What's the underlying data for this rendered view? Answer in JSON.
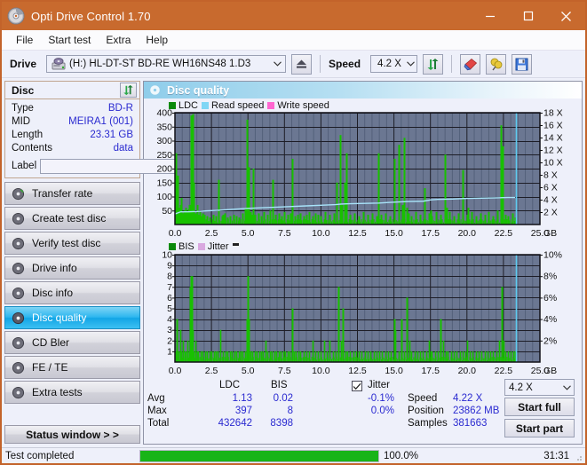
{
  "window": {
    "title": "Opti Drive Control 1.70",
    "icon": "disc-icon",
    "minimize": "minimize-icon",
    "maximize": "maximize-icon",
    "close": "close-icon"
  },
  "menu": {
    "items": [
      "File",
      "Start test",
      "Extra",
      "Help"
    ]
  },
  "toolbar": {
    "drive_label": "Drive",
    "drive_value": "(H:)   HL-DT-ST BD-RE  WH16NS48 1.D3",
    "eject_icon": "eject-icon",
    "speed_label": "Speed",
    "speed_value": "4.2 X",
    "refresh_icon": "refresh-icon",
    "erase_icon": "eraser-icon",
    "settings_icon": "plug-icon",
    "save_icon": "floppy-save-icon"
  },
  "sidebar": {
    "disc_panel": {
      "title": "Disc",
      "refresh_icon": "refresh-icon",
      "rows": [
        {
          "key": "Type",
          "value": "BD-R"
        },
        {
          "key": "MID",
          "value": "MEIRA1 (001)"
        },
        {
          "key": "Length",
          "value": "23.31 GB"
        },
        {
          "key": "Contents",
          "value": "data"
        }
      ],
      "label_key": "Label",
      "label_value": "",
      "label_placeholder": "",
      "disc_button_icon": "cd-icon"
    },
    "items": [
      {
        "label": "Transfer rate",
        "icon": "disc-icon",
        "active": false
      },
      {
        "label": "Create test disc",
        "icon": "disc-icon",
        "active": false
      },
      {
        "label": "Verify test disc",
        "icon": "disc-icon",
        "active": false
      },
      {
        "label": "Drive info",
        "icon": "disc-icon",
        "active": false
      },
      {
        "label": "Disc info",
        "icon": "disc-icon",
        "active": false
      },
      {
        "label": "Disc quality",
        "icon": "disc-icon",
        "active": true
      },
      {
        "label": "CD Bler",
        "icon": "disc-icon",
        "active": false
      },
      {
        "label": "FE / TE",
        "icon": "disc-icon",
        "active": false
      },
      {
        "label": "Extra tests",
        "icon": "disc-icon",
        "active": false
      }
    ],
    "status_window_button": "Status window > >"
  },
  "main": {
    "header_title": "Disc quality",
    "header_icon": "disc-icon"
  },
  "stats": {
    "col_ldc": "LDC",
    "col_bis": "BIS",
    "rows": [
      {
        "label": "Avg",
        "ldc": "1.13",
        "bis": "0.02"
      },
      {
        "label": "Max",
        "ldc": "397",
        "bis": "8"
      },
      {
        "label": "Total",
        "ldc": "432642",
        "bis": "8398"
      }
    ],
    "jitter_checked": true,
    "jitter_label": "Jitter",
    "jitter_values": [
      "-0.1%",
      "0.0%"
    ],
    "speed_label": "Speed",
    "speed_value": "4.22 X",
    "position_label": "Position",
    "position_value": "23862 MB",
    "samples_label": "Samples",
    "samples_value": "381663",
    "speed_select": "4.2 X",
    "start_full_button": "Start full",
    "start_part_button": "Start part"
  },
  "statusbar": {
    "text": "Test completed",
    "progress_percent": 100.0,
    "progress_text": "100.0%",
    "elapsed": "31:31"
  },
  "colors": {
    "titlebar": "#c86a2e",
    "accent_blue": "#2bb6ef",
    "ldc_green": "#18c000",
    "read_speed": "#7fd6f5",
    "write_speed": "#ff66d0",
    "bis_green": "#18c000",
    "jitter": "#d9a8e0",
    "plot_bg": "#6b7792",
    "value_blue": "#2a2ad0",
    "progress_green": "#18b418"
  },
  "chart_data": [
    {
      "type": "line",
      "name": "ldc-chart",
      "title": "",
      "xlabel": "GB",
      "ylabel": "",
      "xlim": [
        0,
        25.0
      ],
      "xticks": [
        "0.0",
        "2.5",
        "5.0",
        "7.5",
        "10.0",
        "12.5",
        "15.0",
        "17.5",
        "20.0",
        "22.5",
        "25.0"
      ],
      "ylim": [
        0,
        400
      ],
      "yticks": [
        "50",
        "100",
        "150",
        "200",
        "250",
        "300",
        "350",
        "400"
      ],
      "y2lim": [
        0,
        18
      ],
      "y2ticks": [
        "2 X",
        "4 X",
        "6 X",
        "8 X",
        "10 X",
        "12 X",
        "14 X",
        "16 X",
        "18 X"
      ],
      "grid": true,
      "legend": [
        {
          "label": "LDC",
          "color": "#18c000"
        },
        {
          "label": "Read speed",
          "color": "#7fd6f5"
        },
        {
          "label": "Write speed",
          "color": "#ff66d0"
        }
      ],
      "series": [
        {
          "name": "LDC",
          "color": "#18c000",
          "kind": "impulse",
          "x": [
            0.05,
            0.12,
            0.2,
            0.3,
            0.38,
            0.45,
            0.55,
            0.62,
            0.7,
            0.8,
            0.9,
            1.0,
            1.1,
            1.15,
            1.2,
            1.25,
            1.3,
            1.4,
            1.5,
            1.6,
            1.7,
            1.8,
            1.9,
            2.0,
            2.2,
            2.4,
            2.6,
            2.8,
            3.0,
            3.2,
            3.3,
            3.4,
            3.6,
            3.8,
            4.0,
            4.2,
            4.4,
            4.6,
            4.8,
            4.95,
            5.0,
            5.05,
            5.2,
            5.3,
            5.35,
            5.5,
            5.7,
            5.9,
            6.1,
            6.3,
            6.5,
            6.7,
            6.9,
            7.1,
            7.3,
            7.5,
            7.7,
            7.9,
            8.0,
            8.2,
            8.4,
            8.6,
            8.8,
            9.0,
            9.2,
            9.4,
            9.6,
            9.8,
            10.0,
            10.3,
            10.6,
            10.9,
            11.1,
            11.3,
            11.45,
            11.6,
            11.75,
            12.0,
            12.3,
            12.6,
            12.9,
            13.2,
            13.5,
            13.8,
            13.9,
            14.1,
            14.4,
            14.7,
            15.0,
            15.05,
            15.3,
            15.6,
            15.7,
            15.9,
            16.0,
            16.2,
            16.5,
            16.8,
            17.1,
            17.4,
            17.5,
            17.6,
            17.9,
            18.2,
            18.5,
            18.6,
            18.8,
            19.1,
            19.4,
            19.7,
            20.0,
            20.1,
            20.3,
            20.6,
            20.9,
            21.2,
            21.5,
            21.8,
            22.1,
            22.35,
            22.45,
            22.6,
            22.8,
            23.1,
            23.3
          ],
          "y": [
            255,
            90,
            175,
            60,
            70,
            95,
            40,
            50,
            60,
            45,
            55,
            70,
            390,
            200,
            395,
            150,
            60,
            40,
            70,
            35,
            45,
            30,
            40,
            35,
            30,
            25,
            35,
            30,
            160,
            30,
            35,
            40,
            25,
            30,
            35,
            30,
            25,
            40,
            60,
            375,
            120,
            205,
            45,
            35,
            200,
            35,
            40,
            30,
            45,
            35,
            50,
            160,
            35,
            40,
            30,
            45,
            35,
            40,
            235,
            30,
            35,
            40,
            30,
            35,
            45,
            30,
            40,
            35,
            30,
            45,
            35,
            40,
            150,
            320,
            70,
            150,
            255,
            35,
            40,
            30,
            45,
            35,
            40,
            30,
            255,
            35,
            40,
            30,
            235,
            70,
            285,
            70,
            310,
            60,
            40,
            30,
            45,
            35,
            130,
            40,
            50,
            30,
            45,
            35,
            250,
            60,
            45,
            30,
            40,
            195,
            35,
            60,
            45,
            30,
            40,
            35,
            45,
            30,
            50,
            355,
            280,
            35,
            30,
            40,
            25
          ]
        },
        {
          "name": "Read speed",
          "color": "#a8e4fa",
          "kind": "line",
          "x": [
            0.0,
            0.4,
            0.9,
            1.5,
            2.2,
            3.0,
            4.0,
            5.0,
            6.0,
            7.0,
            8.0,
            9.0,
            10.0,
            11.0,
            11.4,
            12.0,
            13.0,
            14.0,
            14.6,
            15.0,
            16.0,
            17.0,
            17.5,
            18.0,
            19.0,
            20.0,
            21.0,
            22.0,
            22.8,
            23.3
          ],
          "y": [
            1.7,
            2.05,
            2.05,
            2.1,
            2.2,
            2.3,
            2.45,
            2.6,
            2.7,
            2.8,
            2.9,
            3.0,
            3.1,
            3.2,
            3.3,
            3.35,
            3.4,
            3.45,
            3.55,
            3.6,
            3.7,
            3.75,
            3.95,
            4.05,
            4.1,
            4.2,
            4.25,
            4.3,
            4.35,
            4.35
          ],
          "axis": "right"
        },
        {
          "name": "Write speed",
          "color": "#ff66d0",
          "kind": "line",
          "x": [],
          "y": []
        }
      ],
      "cursor_x": 23.35,
      "cursor_color": "#5ecbf0"
    },
    {
      "type": "line",
      "name": "bis-chart",
      "title": "",
      "xlabel": "GB",
      "ylabel": "",
      "xlim": [
        0,
        25.0
      ],
      "xticks": [
        "0.0",
        "2.5",
        "5.0",
        "7.5",
        "10.0",
        "12.5",
        "15.0",
        "17.5",
        "20.0",
        "22.5",
        "25.0"
      ],
      "ylim": [
        0,
        10
      ],
      "yticks": [
        "1",
        "2",
        "3",
        "4",
        "5",
        "6",
        "7",
        "8",
        "9",
        "10"
      ],
      "y2lim": [
        0,
        10
      ],
      "y2ticks": [
        "2%",
        "4%",
        "6%",
        "8%",
        "10%"
      ],
      "grid": true,
      "legend": [
        {
          "label": "BIS",
          "color": "#18c000"
        },
        {
          "label": "Jitter",
          "color": "#d9a8e0"
        }
      ],
      "series": [
        {
          "name": "BIS",
          "color": "#18c000",
          "kind": "impulse",
          "x": [
            0.05,
            0.15,
            0.25,
            0.35,
            0.45,
            0.55,
            0.65,
            0.75,
            0.85,
            0.95,
            1.05,
            1.1,
            1.15,
            1.2,
            1.3,
            1.4,
            1.5,
            1.6,
            1.75,
            1.9,
            2.05,
            2.2,
            2.35,
            2.5,
            2.65,
            2.8,
            2.95,
            3.1,
            3.3,
            3.45,
            3.6,
            3.75,
            3.9,
            4.05,
            4.2,
            4.35,
            4.5,
            4.65,
            4.8,
            4.95,
            5.0,
            5.05,
            5.15,
            5.3,
            5.45,
            5.6,
            5.75,
            5.9,
            6.05,
            6.2,
            6.35,
            6.5,
            6.65,
            6.8,
            6.95,
            7.1,
            7.25,
            7.4,
            7.55,
            7.7,
            7.85,
            8.0,
            8.15,
            8.3,
            8.45,
            8.6,
            8.8,
            9.0,
            9.2,
            9.4,
            9.6,
            9.8,
            10.0,
            10.2,
            10.4,
            10.6,
            10.8,
            11.0,
            11.2,
            11.35,
            11.5,
            11.65,
            11.8,
            12.0,
            12.2,
            12.4,
            12.6,
            12.8,
            13.0,
            13.2,
            13.4,
            13.6,
            13.8,
            14.0,
            14.2,
            14.4,
            14.6,
            14.8,
            15.0,
            15.1,
            15.3,
            15.5,
            15.7,
            15.9,
            16.05,
            16.2,
            16.4,
            16.6,
            16.8,
            17.0,
            17.2,
            17.4,
            17.5,
            17.6,
            17.8,
            18.0,
            18.2,
            18.4,
            18.55,
            18.7,
            18.9,
            19.1,
            19.3,
            19.5,
            19.7,
            19.9,
            20.0,
            20.2,
            20.4,
            20.6,
            20.8,
            21.0,
            21.2,
            21.4,
            21.6,
            21.8,
            22.0,
            22.2,
            22.4,
            22.5,
            22.65,
            22.8,
            23.0,
            23.2,
            23.3
          ],
          "y": [
            1,
            4,
            1,
            3,
            1,
            2,
            1,
            1,
            2,
            1,
            7,
            8,
            8,
            3,
            1,
            2,
            1,
            1,
            1,
            1,
            1,
            1,
            1,
            1,
            1,
            1,
            1,
            3,
            1,
            1,
            1,
            1,
            1,
            1,
            1,
            1,
            1,
            1,
            1,
            4,
            8,
            4,
            1,
            1,
            1,
            1,
            1,
            1,
            1,
            2,
            1,
            1,
            1,
            1,
            1,
            1,
            1,
            1,
            1,
            1,
            1,
            5,
            1,
            1,
            1,
            1,
            1,
            1,
            1,
            2,
            1,
            1,
            1,
            2,
            1,
            2,
            1,
            1,
            7,
            2,
            5,
            1,
            1,
            1,
            1,
            1,
            1,
            1,
            1,
            1,
            1,
            1,
            1,
            1,
            1,
            1,
            1,
            1,
            4,
            3,
            1,
            4,
            1,
            6,
            2,
            1,
            1,
            1,
            1,
            1,
            1,
            2,
            1,
            1,
            1,
            1,
            4,
            2,
            1,
            1,
            1,
            1,
            1,
            1,
            1,
            1,
            2,
            1,
            1,
            1,
            1,
            1,
            1,
            1,
            1,
            1,
            1,
            2,
            7,
            2,
            1,
            1,
            1,
            1,
            1
          ]
        },
        {
          "name": "Jitter",
          "color": "#d9a8e0",
          "kind": "line",
          "x": [],
          "y": []
        }
      ],
      "cursor_x": 23.35,
      "cursor_color": "#5ecbf0"
    }
  ]
}
